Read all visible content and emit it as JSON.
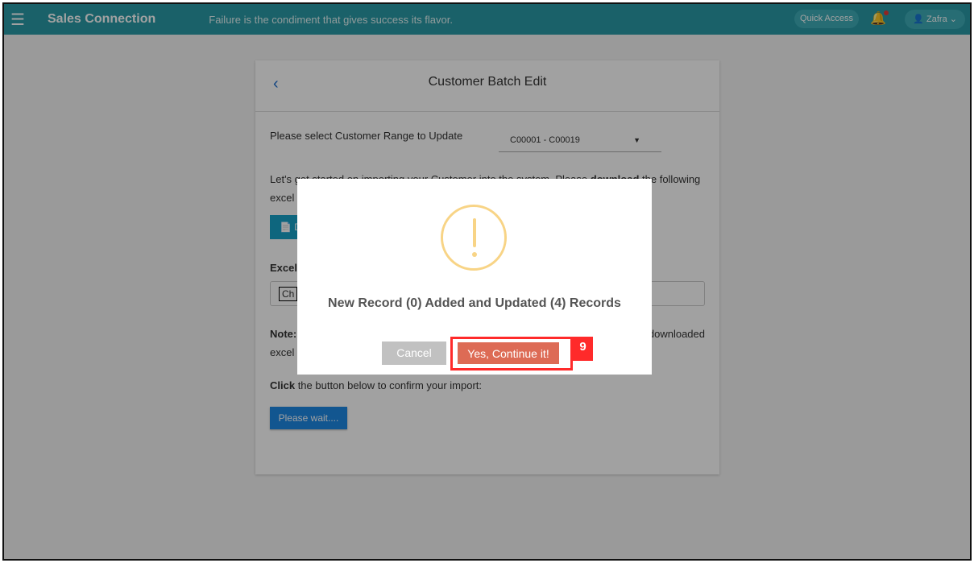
{
  "header": {
    "brand": "Sales Connection",
    "quote": "Failure is the condiment that gives success its flavor.",
    "quick_access": "Quick Access",
    "user": "Zafra"
  },
  "card": {
    "title": "Customer Batch Edit",
    "range_label": "Please select Customer Range to Update",
    "range_value": "C00001 - C00019",
    "intro_pre": "Let's get started on importing your Customer into the system. Please ",
    "intro_bold": "download",
    "intro_post": " the following",
    "intro_line2": "excel",
    "download_label": "D",
    "excel_label": "Excel",
    "file_button": "Ch",
    "note_label": "Note:",
    "note_tail": "downloaded",
    "note_line2": "excel",
    "click_bold": "Click",
    "click_rest": " the button below to confirm your import:",
    "wait_button": "Please wait...."
  },
  "modal": {
    "icon": "warning-icon",
    "message": "New Record (0) Added and Updated (4) Records",
    "cancel": "Cancel",
    "confirm": "Yes, Continue it!",
    "step_badge": "9"
  }
}
